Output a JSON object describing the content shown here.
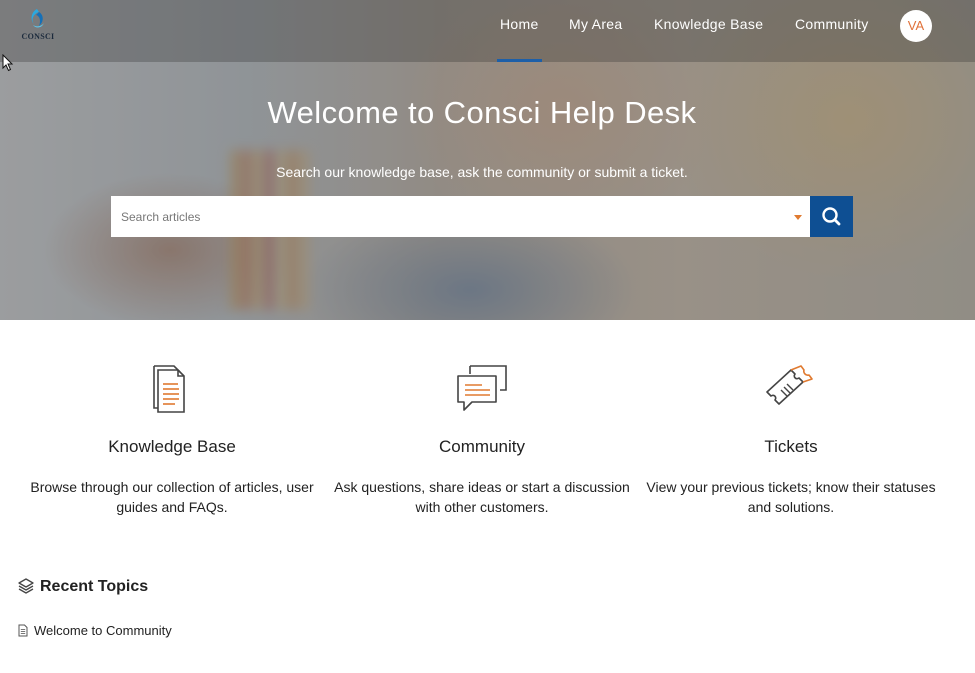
{
  "brand": {
    "logo_text": "CONSCI",
    "accent": "#1d5fa8",
    "orange": "#e07a30"
  },
  "nav": {
    "items": [
      {
        "label": "Home",
        "active": true
      },
      {
        "label": "My Area"
      },
      {
        "label": "Knowledge Base"
      },
      {
        "label": "Community"
      }
    ],
    "avatar_initials": "VA"
  },
  "hero": {
    "title": "Welcome to Consci Help Desk",
    "subtitle": "Search our knowledge base, ask the community or submit a ticket.",
    "search_placeholder": "Search articles"
  },
  "features": [
    {
      "icon": "document-stack-icon",
      "title": "Knowledge Base",
      "description": "Browse through our collection of articles, user guides and FAQs."
    },
    {
      "icon": "chat-bubbles-icon",
      "title": "Community",
      "description": "Ask questions, share ideas or start a discussion with other customers."
    },
    {
      "icon": "ticket-icon",
      "title": "Tickets",
      "description": "View your previous tickets; know their statuses and solutions."
    }
  ],
  "recent": {
    "title": "Recent Topics",
    "topics": [
      {
        "label": "Welcome to Community"
      }
    ]
  }
}
